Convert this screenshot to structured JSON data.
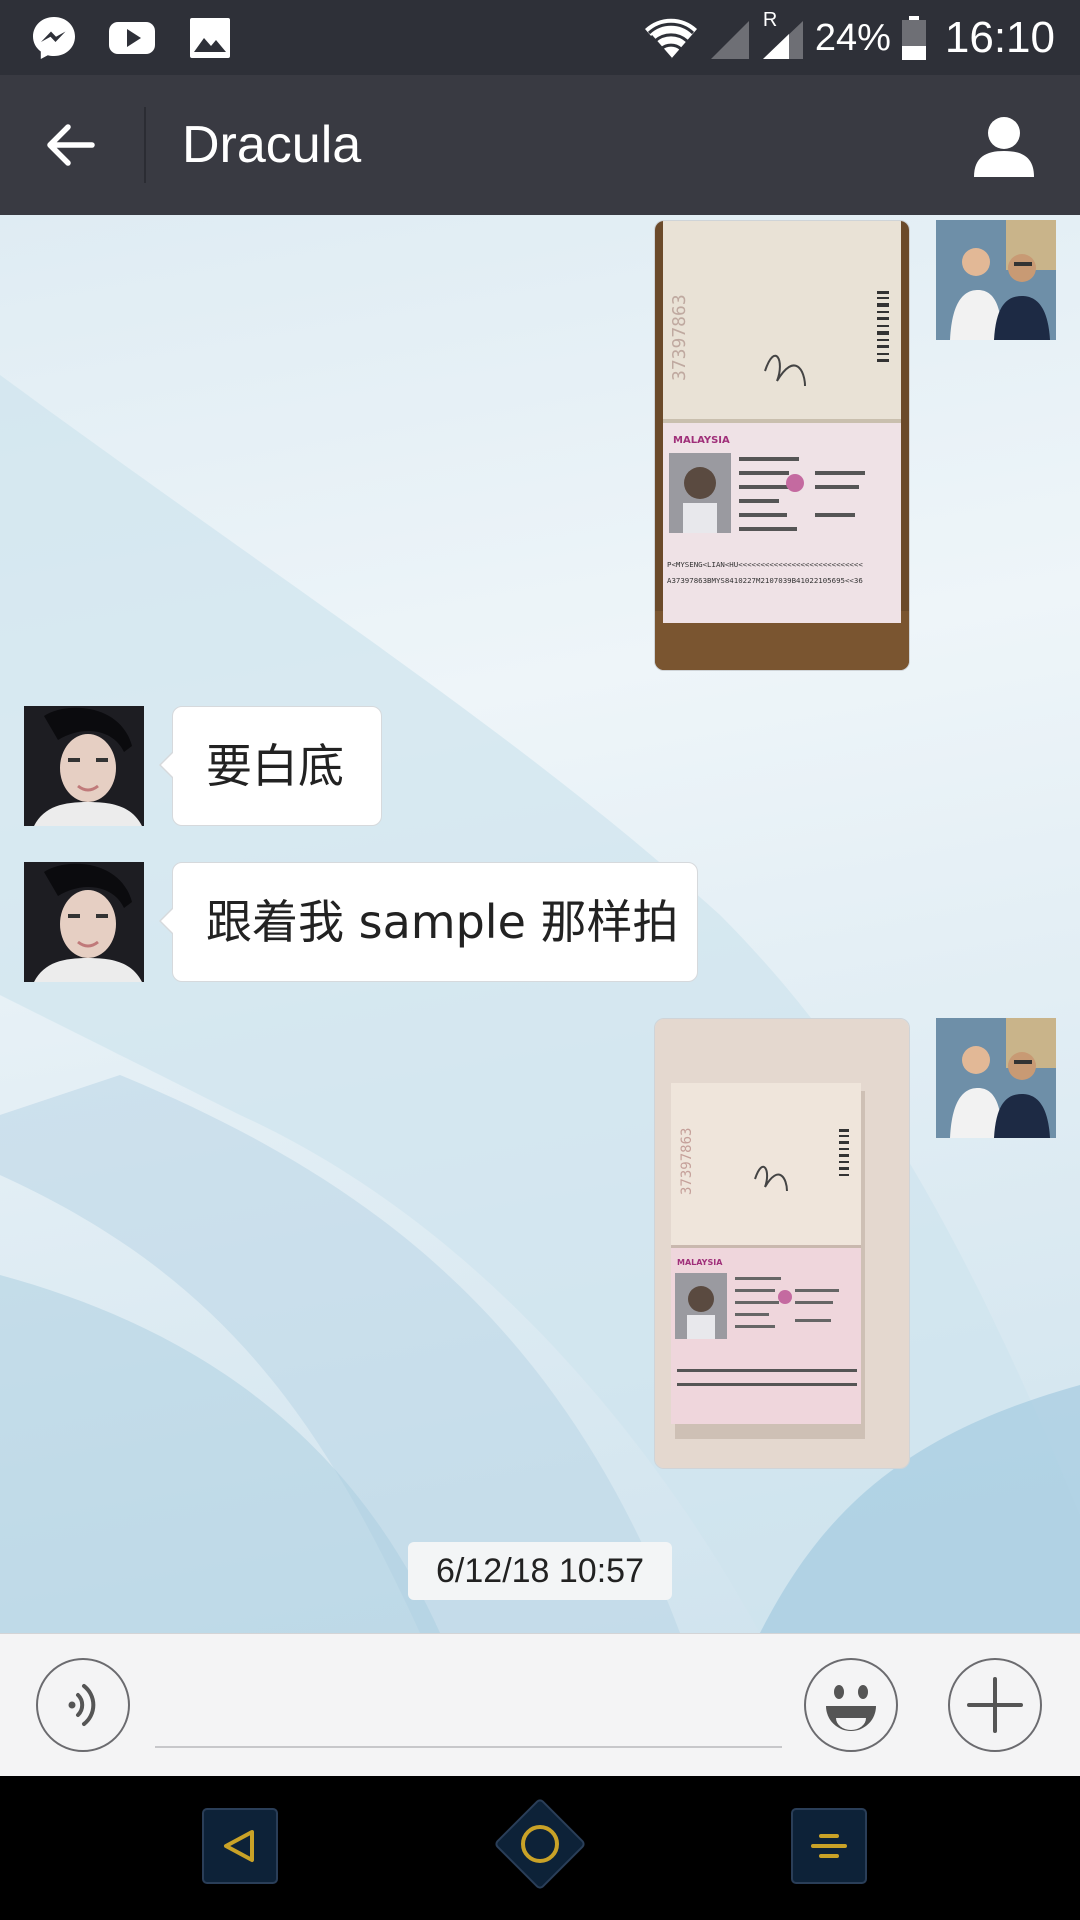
{
  "status_bar": {
    "battery": "24%",
    "time": "16:10",
    "roaming": "R",
    "left_icons": [
      "messenger-icon",
      "youtube-icon",
      "gallery-icon"
    ],
    "right_icons": [
      "wifi-icon",
      "signal-icon",
      "signal-roaming-icon",
      "battery-icon"
    ]
  },
  "header": {
    "title": "Dracula",
    "back_icon": "arrow-left-icon",
    "profile_icon": "person-icon"
  },
  "messages": [
    {
      "id": 1,
      "direction": "outgoing",
      "type": "image",
      "content": "passport-photo",
      "passport": {
        "country": "MALAYSIA",
        "number": "37397863",
        "mrz_1": "P<MYSENG<LIAN<HU<<<<<<<<<<<<<<<<<<<<<<<<<<<<",
        "mrz_2": "A37397863BMYS8410227M2107039B41022105695<<36"
      }
    },
    {
      "id": 2,
      "direction": "incoming",
      "type": "text",
      "text": "要白底"
    },
    {
      "id": 3,
      "direction": "incoming",
      "type": "text",
      "text": "跟着我 sample 那样拍"
    },
    {
      "id": 4,
      "direction": "outgoing",
      "type": "image",
      "content": "passport-photo",
      "passport": {
        "country": "MALAYSIA",
        "number": "37397863"
      }
    }
  ],
  "timestamp": "6/12/18 10:57",
  "input_bar": {
    "voice_icon": "voice-icon",
    "emoji_icon": "smiley-icon",
    "plus_icon": "plus-icon",
    "input_value": ""
  },
  "nav_bar": {
    "icons": [
      "back-triangle-icon",
      "home-circle-icon",
      "menu-icon"
    ],
    "accent": "#c9a227"
  },
  "colors": {
    "status_bar": "#2e3038",
    "header": "#393a42",
    "bubble": "#ffffff",
    "input_bar": "#f4f4f5",
    "nav_bar": "#000000"
  }
}
